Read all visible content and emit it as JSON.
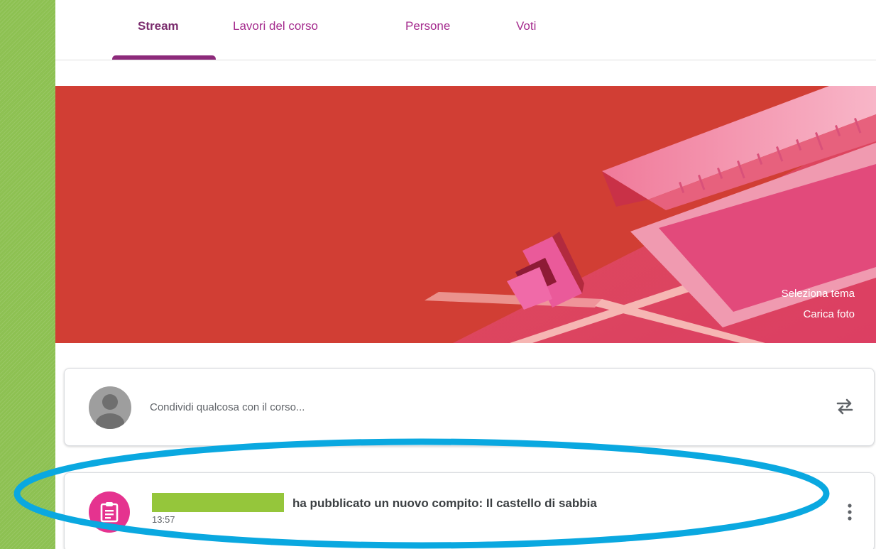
{
  "tabs": [
    {
      "label": "Stream",
      "active": true
    },
    {
      "label": "Lavori del corso",
      "active": false
    },
    {
      "label": "Persone",
      "active": false
    },
    {
      "label": "Voti",
      "active": false
    }
  ],
  "banner": {
    "select_theme": "Seleziona tema",
    "upload_photo": "Carica foto",
    "color": "#d13e34"
  },
  "share": {
    "placeholder": "Condividi qualcosa con il corso..."
  },
  "post": {
    "text": "ha pubblicato un nuovo compito: Il castello di sabbia",
    "time": "13:57",
    "icon": "assignment-icon"
  },
  "colors": {
    "accent": "#8d2a7b",
    "tab_text": "#a52c8e",
    "assignment_icon": "#e5338f",
    "highlight": "#0aa8e0",
    "redaction": "#95c63b"
  }
}
